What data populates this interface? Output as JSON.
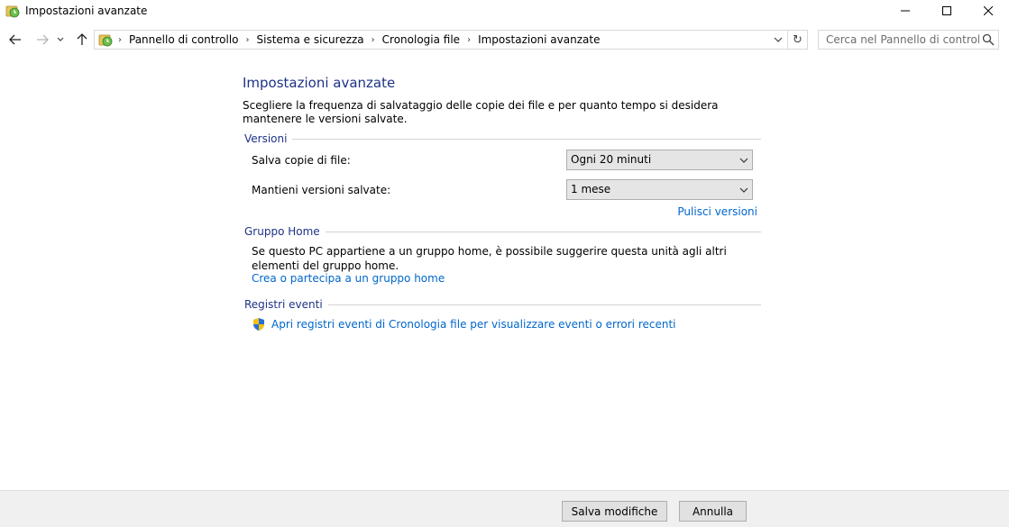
{
  "window": {
    "title": "Impostazioni avanzate",
    "icons": {
      "app": "file-history-icon",
      "minimize": "minimize-icon",
      "maximize": "maximize-icon",
      "close": "close-icon"
    }
  },
  "navbar": {
    "icons": {
      "back": "arrow-left-icon",
      "forward": "arrow-right-icon",
      "recent": "chevron-down-icon",
      "up": "arrow-up-icon",
      "location": "file-history-icon",
      "dropdown": "chevron-down-icon",
      "refresh": "refresh-icon"
    },
    "breadcrumbs": [
      "Pannello di controllo",
      "Sistema e sicurezza",
      "Cronologia file",
      "Impostazioni avanzate"
    ],
    "search": {
      "placeholder": "Cerca nel Pannello di controllo",
      "value": ""
    }
  },
  "main": {
    "title": "Impostazioni avanzate",
    "intro": "Scegliere la frequenza di salvataggio delle copie dei file e per quanto tempo si desidera mantenere le versioni salvate.",
    "versions": {
      "heading": "Versioni",
      "save_copies_label": "Salva copie di file:",
      "save_copies_value": "Ogni 20 minuti",
      "keep_versions_label": "Mantieni versioni salvate:",
      "keep_versions_value": "1 mese",
      "cleanup_link": "Pulisci versioni"
    },
    "homegroup": {
      "heading": "Gruppo Home",
      "text": "Se questo PC appartiene a un gruppo home, è possibile suggerire questa unità agli altri elementi del gruppo home.",
      "link": "Crea o partecipa a un gruppo home"
    },
    "event_logs": {
      "heading": "Registri eventi",
      "link": "Apri registri eventi di Cronologia file per visualizzare eventi o errori recenti",
      "icon": "uac-shield-icon"
    }
  },
  "footer": {
    "save_label": "Salva modifiche",
    "cancel_label": "Annulla"
  },
  "colors": {
    "heading": "#1e3287",
    "link": "#0066cc",
    "footer_bg": "#f0f0f0"
  }
}
